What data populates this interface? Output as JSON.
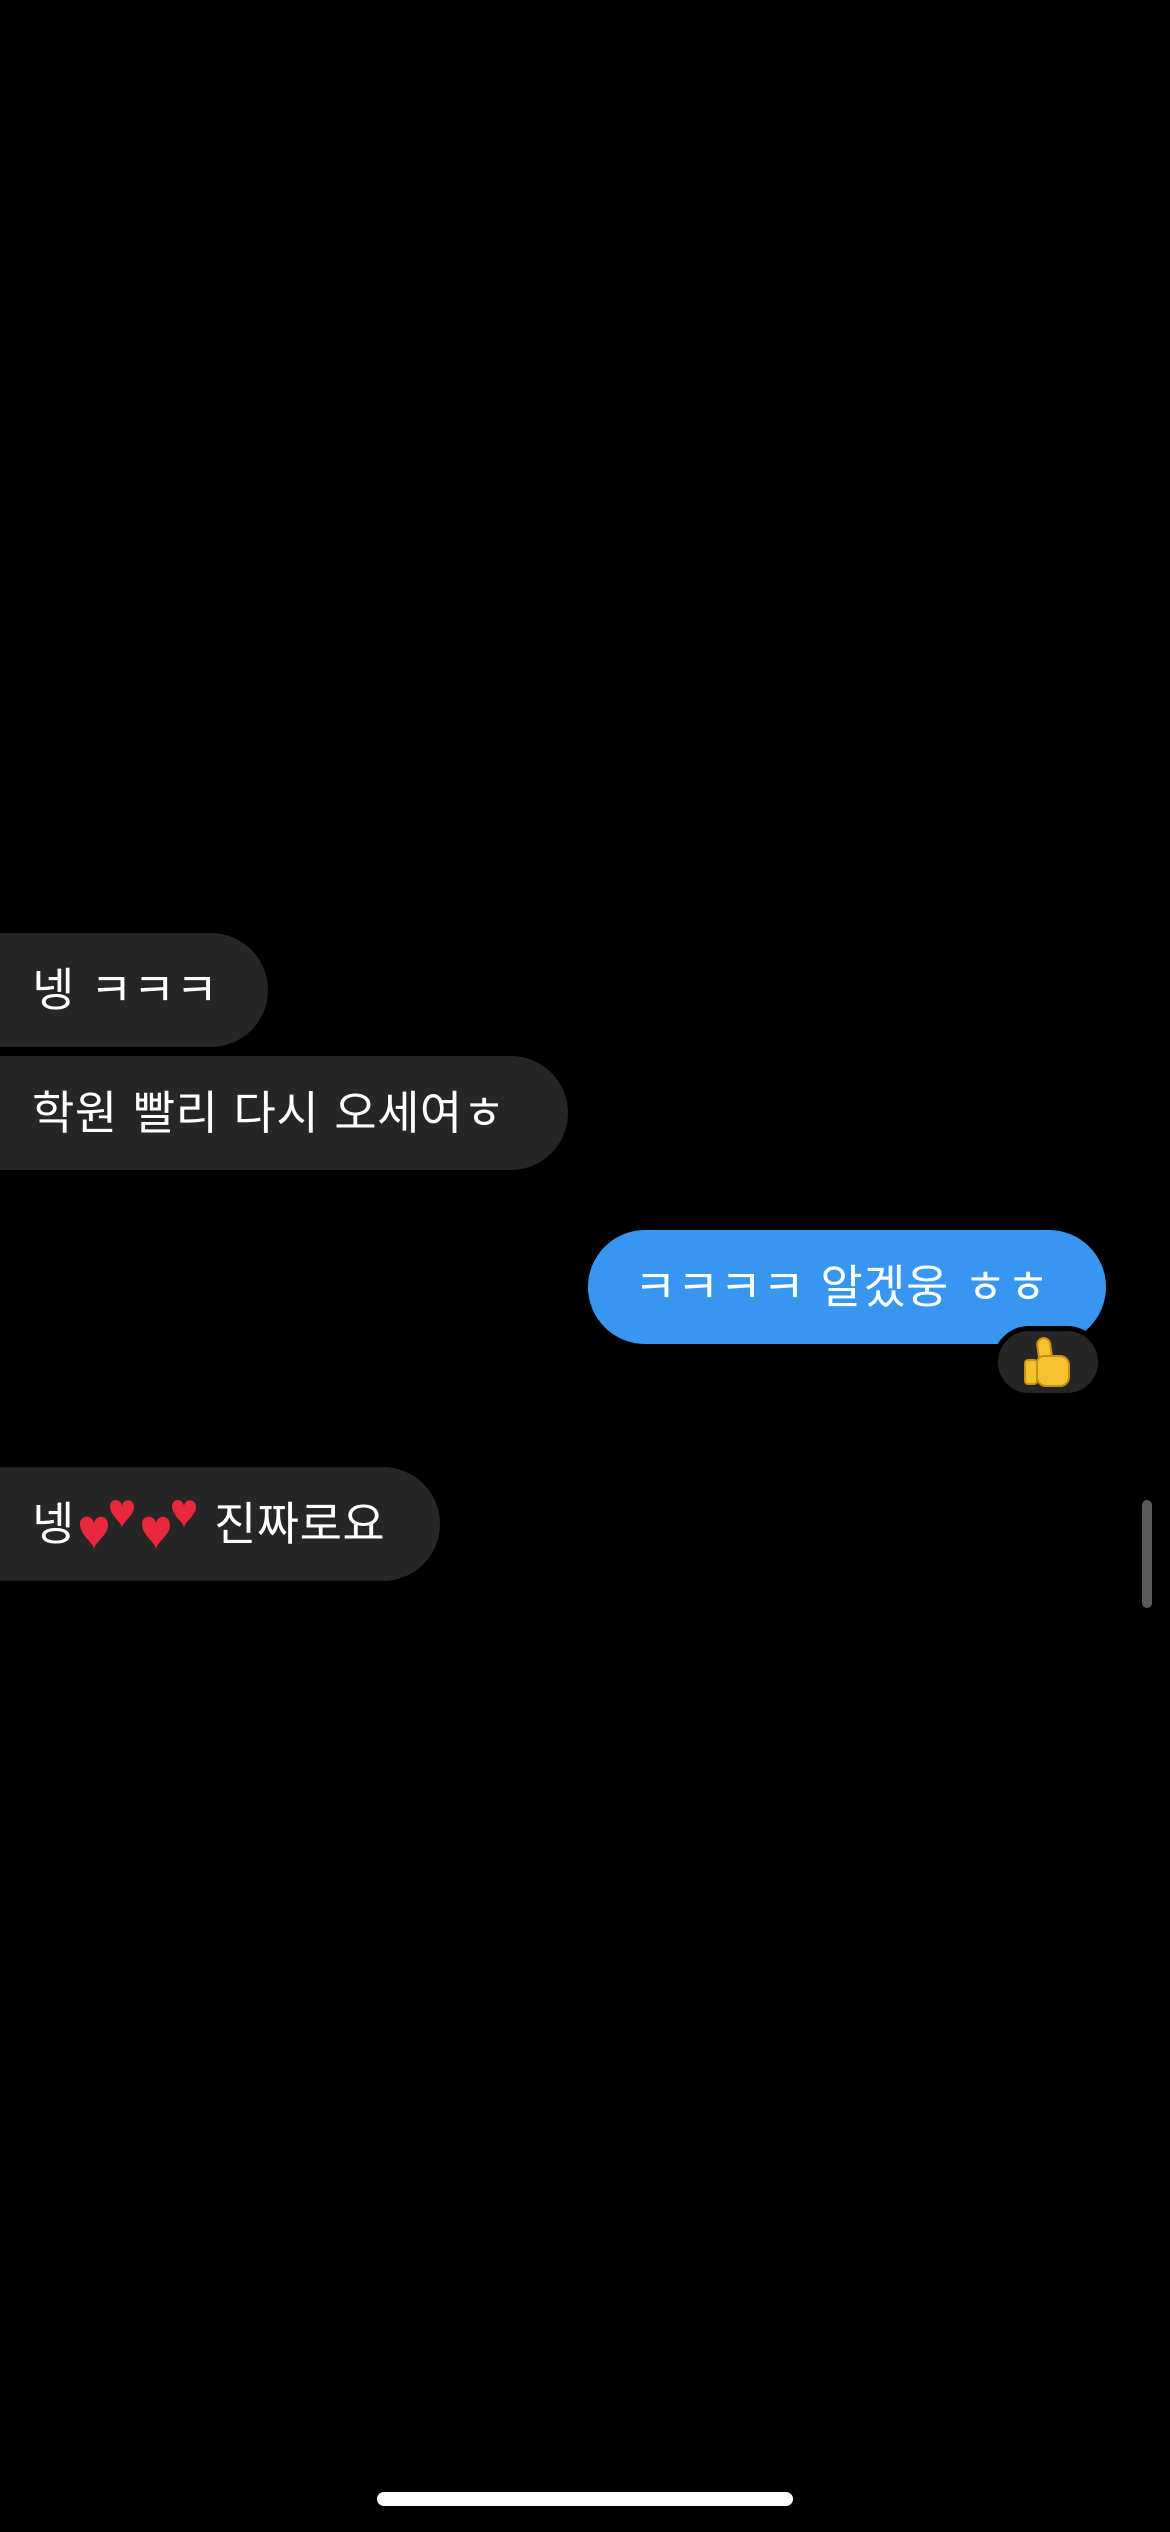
{
  "conversation": {
    "messages": [
      {
        "direction": "incoming",
        "text": "넹 ㅋㅋㅋ"
      },
      {
        "direction": "incoming",
        "text": "학원 빨리 다시 오세여ㅎ"
      },
      {
        "direction": "outgoing",
        "text": "ㅋㅋㅋㅋ 알겠웅 ㅎㅎ",
        "reaction": "thumbs-up"
      },
      {
        "direction": "incoming",
        "text_before": "넹",
        "emoji": "two-hearts",
        "emoji_count": 2,
        "text_after": " 진짜로요"
      }
    ]
  },
  "colors": {
    "background": "#000000",
    "incoming_bubble": "#262626",
    "outgoing_bubble": "#3797f0",
    "text": "#ffffff"
  }
}
